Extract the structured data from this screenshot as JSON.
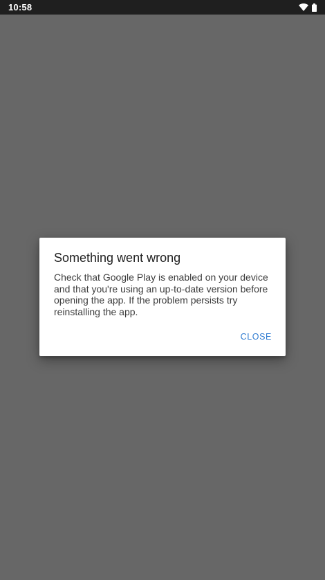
{
  "status_bar": {
    "time": "10:58",
    "icons": [
      "wifi-icon",
      "battery-icon"
    ]
  },
  "dialog": {
    "title": "Something went wrong",
    "message": "Check that Google Play is enabled on your device and that you're using an up-to-date version before opening the app. If the problem persists try reinstalling the app.",
    "close_label": "CLOSE"
  },
  "colors": {
    "scrim": "#676767",
    "status_bar": "#1f1f1f",
    "dialog_background": "#ffffff",
    "accent": "#2f7bd1"
  }
}
